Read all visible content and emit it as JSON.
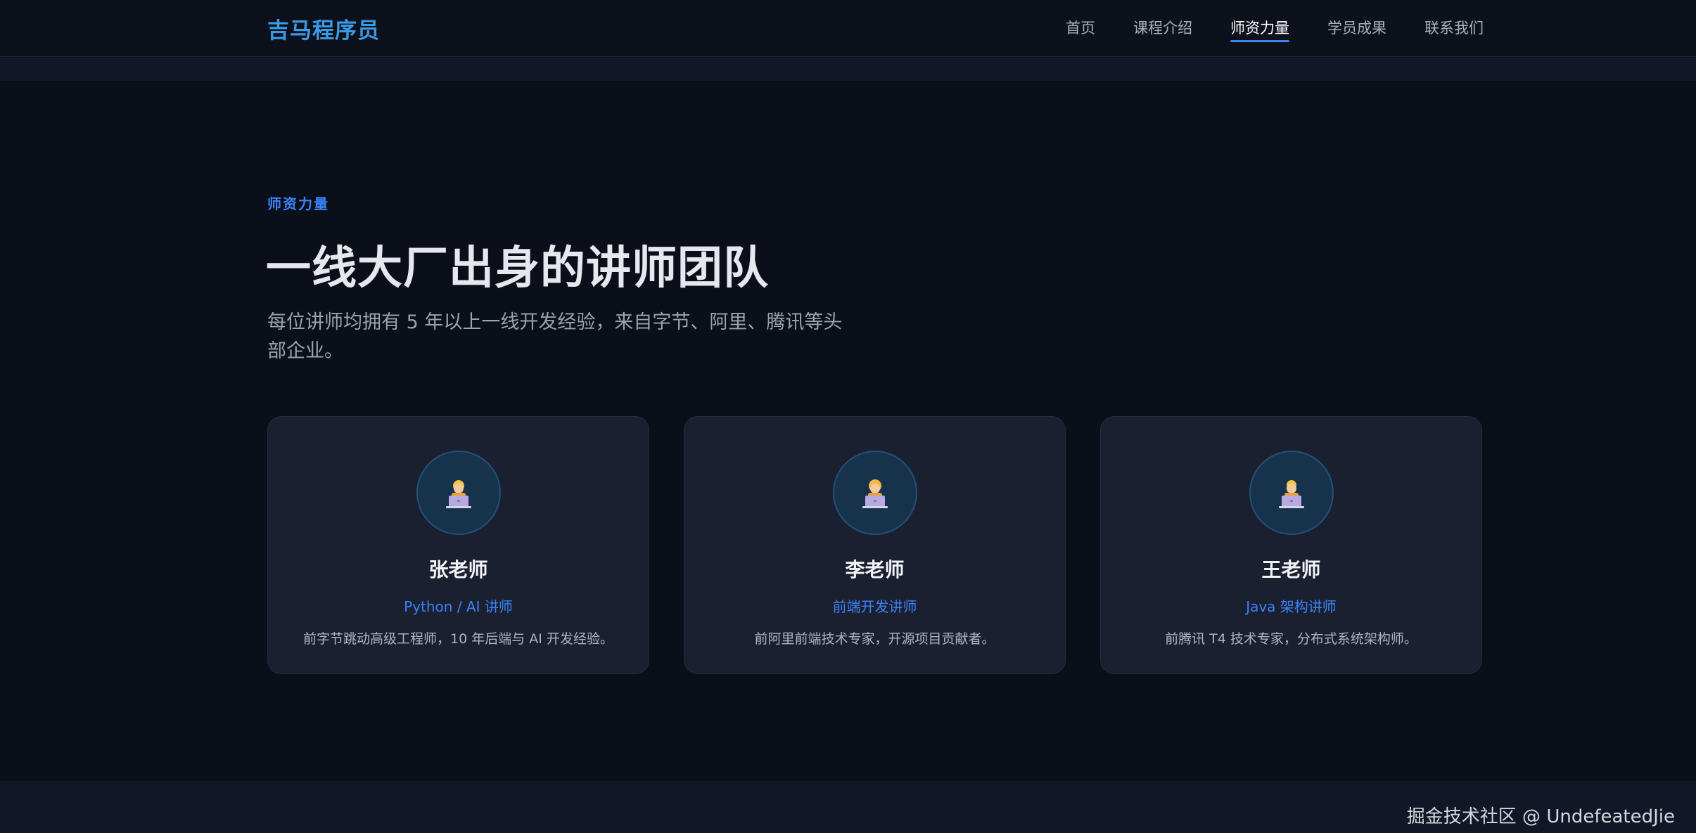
{
  "header": {
    "brand": "吉马程序员",
    "nav": [
      {
        "label": "首页",
        "active": false
      },
      {
        "label": "课程介绍",
        "active": false
      },
      {
        "label": "师资力量",
        "active": true
      },
      {
        "label": "学员成果",
        "active": false
      },
      {
        "label": "联系我们",
        "active": false
      }
    ]
  },
  "section": {
    "eyebrow": "师资力量",
    "title": "一线大厂出身的讲师团队",
    "subtitle": "每位讲师均拥有 5 年以上一线开发经验，来自字节、阿里、腾讯等头部企业。"
  },
  "teachers": [
    {
      "avatar_icon": "technologist-emoji-icon",
      "name": "张老师",
      "role": "Python / AI 讲师",
      "desc": "前字节跳动高级工程师，10 年后端与 AI 开发经验。"
    },
    {
      "avatar_icon": "technologist-emoji-icon",
      "name": "李老师",
      "role": "前端开发讲师",
      "desc": "前阿里前端技术专家，开源项目贡献者。"
    },
    {
      "avatar_icon": "technologist-emoji-icon",
      "name": "王老师",
      "role": "Java 架构讲师",
      "desc": "前腾讯 T4 技术专家，分布式系统架构师。"
    }
  ],
  "footer": {
    "watermark": "掘金技术社区 @ UndefeatedJie"
  },
  "colors": {
    "accent": "#3b82f6",
    "brand": "#3b9ae6",
    "background": "#0b0f19",
    "card": "#1b2030"
  }
}
